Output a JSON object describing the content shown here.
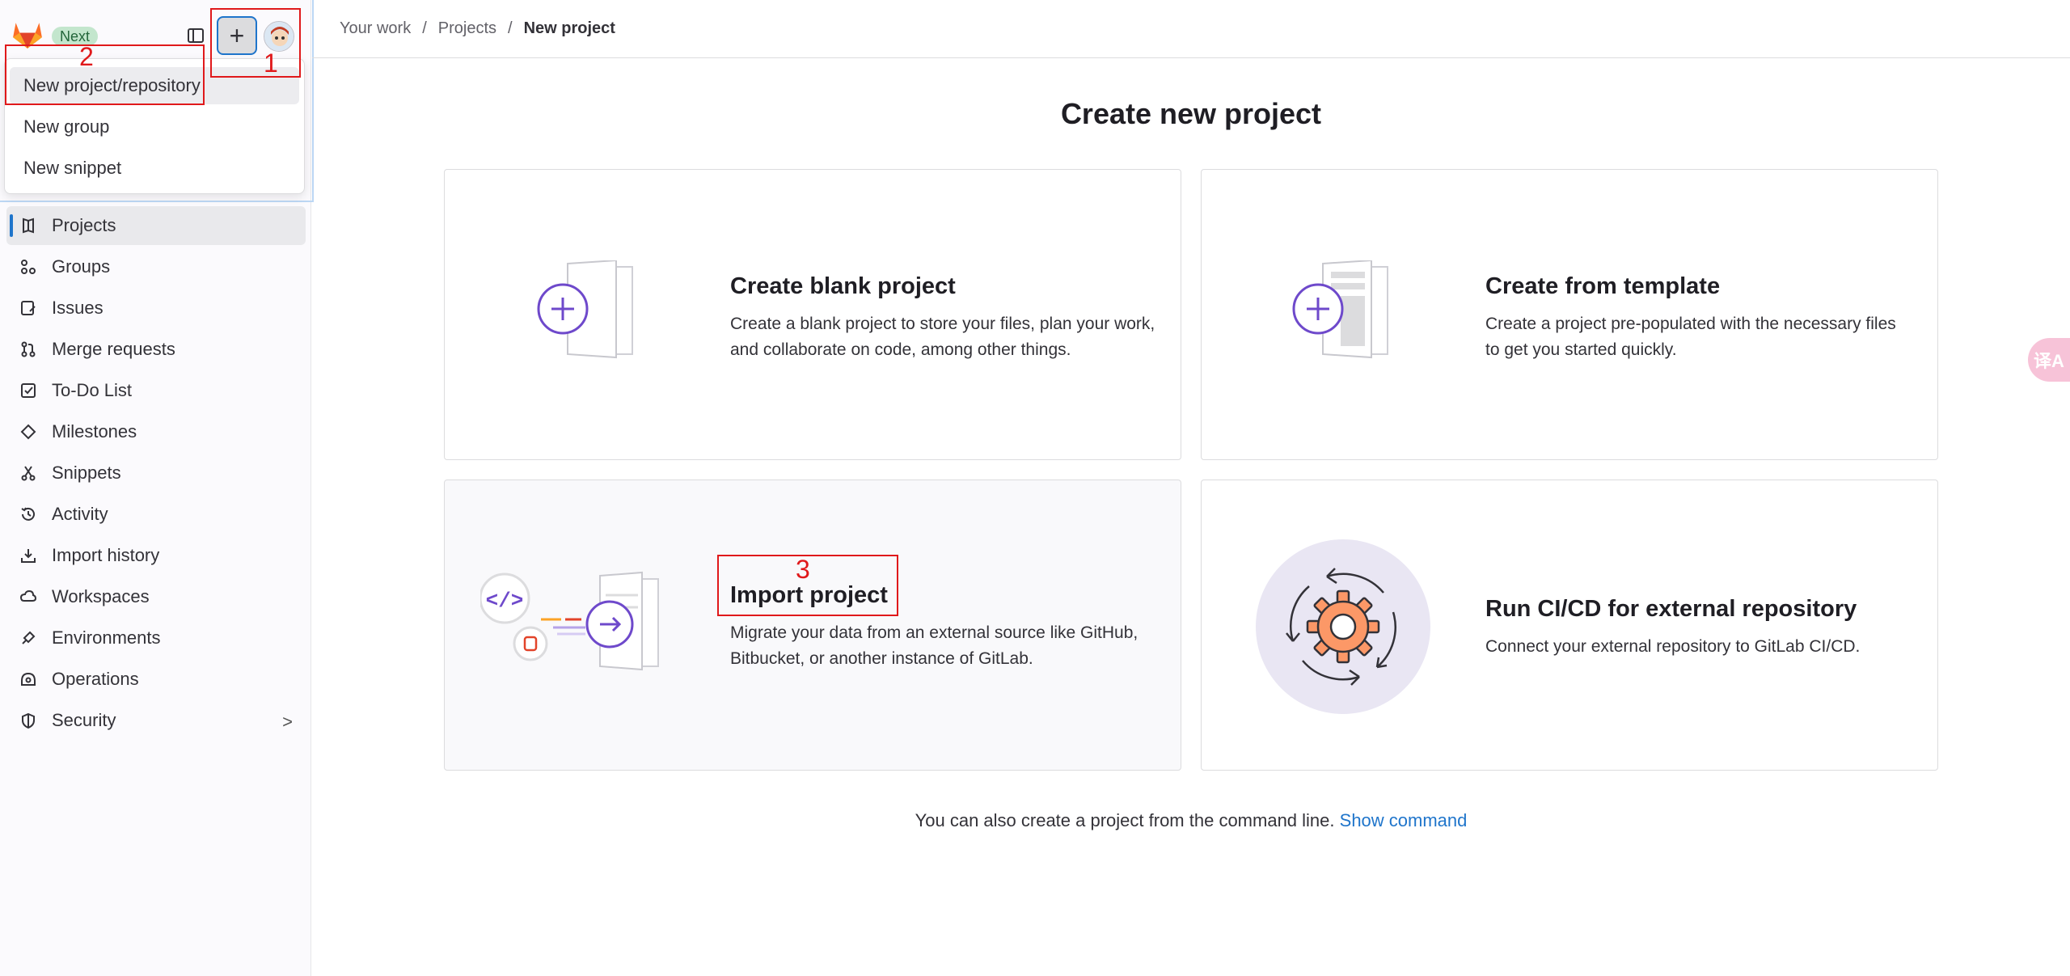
{
  "topbar": {
    "badge": "Next",
    "plus_symbol": "+"
  },
  "dropdown": {
    "items": [
      {
        "label": "New project/repository"
      },
      {
        "label": "New group"
      },
      {
        "label": "New snippet"
      }
    ]
  },
  "sidebar": {
    "items": [
      {
        "label": "Projects",
        "icon": "project-icon",
        "active": true
      },
      {
        "label": "Groups",
        "icon": "group-icon"
      },
      {
        "label": "Issues",
        "icon": "issues-icon"
      },
      {
        "label": "Merge requests",
        "icon": "merge-request-icon"
      },
      {
        "label": "To-Do List",
        "icon": "todo-icon"
      },
      {
        "label": "Milestones",
        "icon": "milestone-icon"
      },
      {
        "label": "Snippets",
        "icon": "snippet-icon"
      },
      {
        "label": "Activity",
        "icon": "history-icon"
      },
      {
        "label": "Import history",
        "icon": "import-icon"
      },
      {
        "label": "Workspaces",
        "icon": "cloud-icon"
      },
      {
        "label": "Environments",
        "icon": "environment-icon"
      },
      {
        "label": "Operations",
        "icon": "operations-icon"
      },
      {
        "label": "Security",
        "icon": "shield-icon",
        "chevron": ">"
      }
    ]
  },
  "breadcrumb": {
    "items": [
      "Your work",
      "Projects",
      "New project"
    ],
    "separator": "/"
  },
  "main": {
    "title": "Create new project",
    "cards": [
      {
        "title": "Create blank project",
        "description": "Create a blank project to store your files, plan your work, and collaborate on code, among other things."
      },
      {
        "title": "Create from template",
        "description": "Create a project pre-populated with the necessary files to get you started quickly."
      },
      {
        "title": "Import project",
        "description": "Migrate your data from an external source like GitHub, Bitbucket, or another instance of GitLab."
      },
      {
        "title": "Run CI/CD for external repository",
        "description": "Connect your external repository to GitLab CI/CD."
      }
    ],
    "footer_text": "You can also create a project from the command line.",
    "footer_link": "Show command"
  },
  "annotations": [
    "1",
    "2",
    "3"
  ],
  "translate_label": "译A",
  "colors": {
    "accent": "#1f75cb",
    "purple": "#6e49cb",
    "annotation": "#e0191b",
    "orange": "#e24329"
  }
}
